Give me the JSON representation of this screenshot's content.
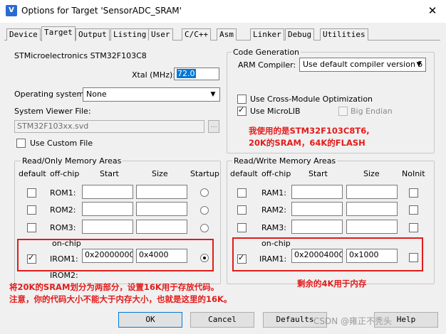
{
  "window": {
    "title": "Options for Target 'SensorADC_SRAM'",
    "close_glyph": "✕"
  },
  "tabs": [
    "Device",
    "Target",
    "Output",
    "Listing",
    "User",
    "C/C++",
    "Asm",
    "Linker",
    "Debug",
    "Utilities"
  ],
  "active_tab": "Target",
  "device": {
    "name": "STMicroelectronics STM32F103C8",
    "xtal_label": "Xtal (MHz):",
    "xtal_value": "72.0"
  },
  "os": {
    "label": "Operating system:",
    "value": "None"
  },
  "svf": {
    "label": "System Viewer File:",
    "value": "STM32F103xx.svd",
    "browse": "..."
  },
  "custom_file": {
    "label": "Use Custom File",
    "checked": false
  },
  "codegen": {
    "group": "Code Generation",
    "compiler_label": "ARM Compiler:",
    "compiler_value": "Use default compiler version 5",
    "cross_module": {
      "label": "Use Cross-Module Optimization",
      "checked": false
    },
    "microlib": {
      "label": "Use MicroLIB",
      "checked": true
    },
    "big_endian": {
      "label": "Big Endian",
      "checked": false
    }
  },
  "annotations": {
    "top_right_1": "我使用的是STM32F103C8T6,",
    "top_right_2": "20K的SRAM，64K的FLASH",
    "bottom_left_1": "将20K的SRAM划分为两部分，设置16K用于存放代码。",
    "bottom_left_2": "注意，你的代码大小不能大于内存大小，也就是这里的16K。",
    "bottom_right": "剩余的4K用于内存"
  },
  "rom": {
    "group": "Read/Only Memory Areas",
    "headers": {
      "default": "default",
      "offchip": "off-chip",
      "start": "Start",
      "size": "Size",
      "startup": "Startup"
    },
    "onchip": "on-chip",
    "rows": [
      {
        "name": "ROM1:",
        "start": "",
        "size": "",
        "default": false,
        "startup": false
      },
      {
        "name": "ROM2:",
        "start": "",
        "size": "",
        "default": false,
        "startup": false
      },
      {
        "name": "ROM3:",
        "start": "",
        "size": "",
        "default": false,
        "startup": false
      },
      {
        "name": "IROM1:",
        "start": "0x20000000",
        "size": "0x4000",
        "default": true,
        "startup": true
      },
      {
        "name": "IROM2:"
      }
    ]
  },
  "ram": {
    "group": "Read/Write Memory Areas",
    "headers": {
      "default": "default",
      "offchip": "off-chip",
      "start": "Start",
      "size": "Size",
      "noinit": "NoInit"
    },
    "onchip": "on-chip",
    "rows": [
      {
        "name": "RAM1:",
        "start": "",
        "size": "",
        "default": false,
        "noinit": false
      },
      {
        "name": "RAM2:",
        "start": "",
        "size": "",
        "default": false,
        "noinit": false
      },
      {
        "name": "RAM3:",
        "start": "",
        "size": "",
        "default": false,
        "noinit": false
      },
      {
        "name": "IRAM1:",
        "start": "0x20004000",
        "size": "0x1000",
        "default": true,
        "noinit": false
      }
    ]
  },
  "buttons": {
    "ok": "OK",
    "cancel": "Cancel",
    "defaults": "Defaults",
    "help": "Help"
  },
  "watermark": "CSDN @雍正不秃头"
}
